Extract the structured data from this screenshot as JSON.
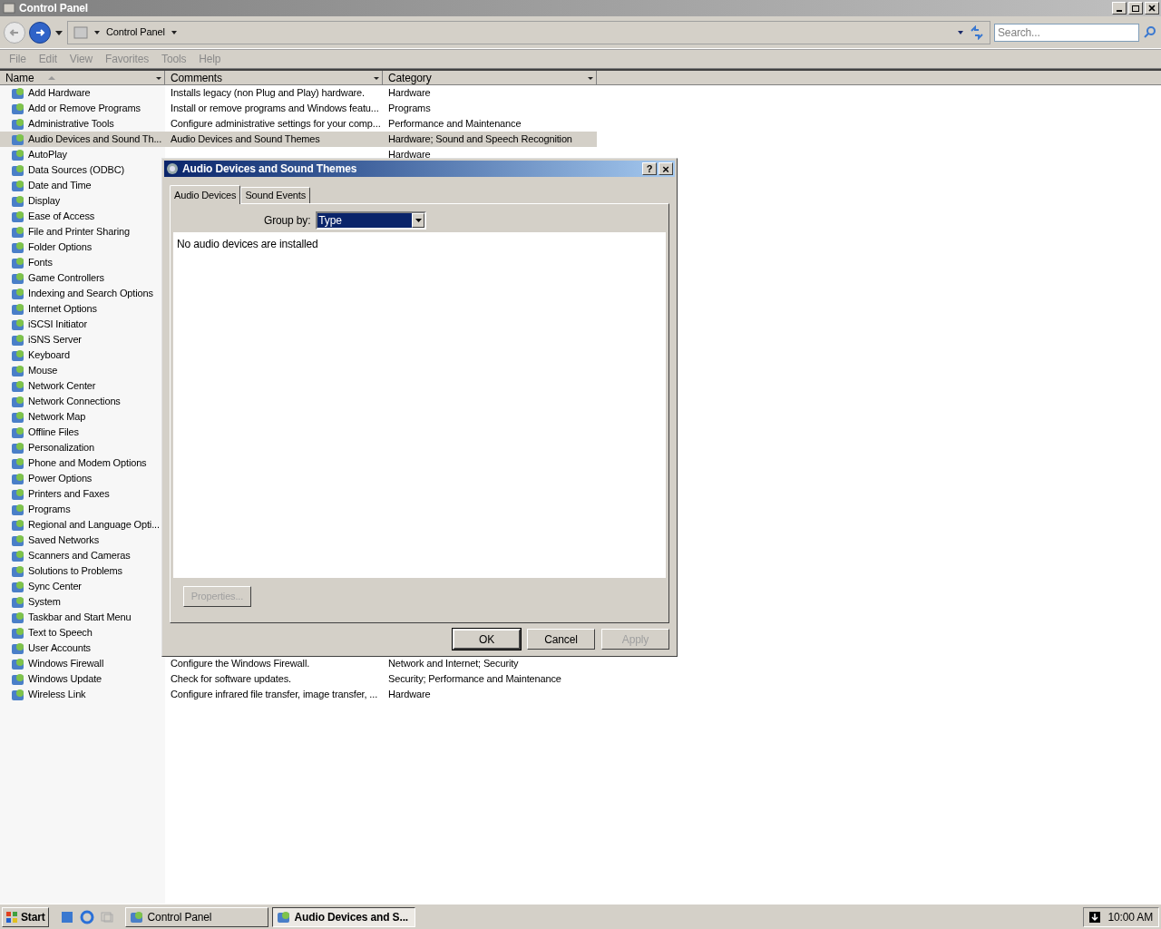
{
  "window": {
    "title": "Control Panel"
  },
  "address": {
    "path": "Control Panel"
  },
  "search": {
    "placeholder": "Search..."
  },
  "menu": [
    "File",
    "Edit",
    "View",
    "Favorites",
    "Tools",
    "Help"
  ],
  "columns": [
    {
      "label": "Name",
      "sorted": true
    },
    {
      "label": "Comments",
      "sorted": false
    },
    {
      "label": "Category",
      "sorted": false
    }
  ],
  "rows": [
    {
      "name": "Add Hardware",
      "comment": "Installs legacy (non Plug and Play) hardware.",
      "category": "Hardware",
      "selected": false
    },
    {
      "name": "Add or Remove Programs",
      "comment": "Install or remove programs and Windows featu...",
      "category": "Programs",
      "selected": false
    },
    {
      "name": "Administrative Tools",
      "comment": "Configure administrative settings for your comp...",
      "category": "Performance and Maintenance",
      "selected": false
    },
    {
      "name": "Audio Devices and Sound Th...",
      "comment": "Audio Devices and Sound Themes",
      "category": "Hardware; Sound and Speech Recognition",
      "selected": true
    },
    {
      "name": "AutoPlay",
      "category": "Hardware",
      "selected": false
    },
    {
      "name": "Data Sources (ODBC)",
      "selected": false
    },
    {
      "name": "Date and Time",
      "selected": false
    },
    {
      "name": "Display",
      "selected": false
    },
    {
      "name": "Ease of Access",
      "selected": false
    },
    {
      "name": "File and Printer Sharing",
      "selected": false
    },
    {
      "name": "Folder Options",
      "selected": false
    },
    {
      "name": "Fonts",
      "selected": false
    },
    {
      "name": "Game Controllers",
      "selected": false
    },
    {
      "name": "Indexing and Search Options",
      "selected": false
    },
    {
      "name": "Internet Options",
      "selected": false
    },
    {
      "name": "iSCSI Initiator",
      "selected": false
    },
    {
      "name": "iSNS Server",
      "selected": false
    },
    {
      "name": "Keyboard",
      "selected": false
    },
    {
      "name": "Mouse",
      "selected": false
    },
    {
      "name": "Network Center",
      "selected": false
    },
    {
      "name": "Network Connections",
      "selected": false
    },
    {
      "name": "Network Map",
      "selected": false
    },
    {
      "name": "Offline Files",
      "selected": false
    },
    {
      "name": "Personalization",
      "selected": false
    },
    {
      "name": "Phone and Modem Options",
      "selected": false
    },
    {
      "name": "Power Options",
      "selected": false
    },
    {
      "name": "Printers and Faxes",
      "selected": false
    },
    {
      "name": "Programs",
      "selected": false
    },
    {
      "name": "Regional and Language Opti...",
      "selected": false
    },
    {
      "name": "Saved Networks",
      "selected": false
    },
    {
      "name": "Scanners and Cameras",
      "selected": false
    },
    {
      "name": "Solutions to Problems",
      "selected": false
    },
    {
      "name": "Sync Center",
      "selected": false
    },
    {
      "name": "System",
      "selected": false
    },
    {
      "name": "Taskbar and Start Menu",
      "selected": false
    },
    {
      "name": "Text to Speech",
      "selected": false
    },
    {
      "name": "User Accounts",
      "selected": false
    },
    {
      "name": "Windows Firewall",
      "comment": "Configure the Windows Firewall.",
      "category": "Network and Internet; Security",
      "selected": false
    },
    {
      "name": "Windows Update",
      "comment": "Check for software updates.",
      "category": "Security; Performance and Maintenance",
      "selected": false
    },
    {
      "name": "Wireless Link",
      "comment": "Configure infrared file transfer, image transfer, ...",
      "category": "Hardware",
      "selected": false
    }
  ],
  "dialog": {
    "title": "Audio Devices and Sound Themes",
    "help": "?",
    "close": "×",
    "tabs": [
      {
        "label": "Audio Devices",
        "selected": true
      },
      {
        "label": "Sound Events",
        "selected": false
      }
    ],
    "group_by": {
      "label": "Group by:",
      "value": "Type"
    },
    "message": "No audio devices are installed",
    "properties": {
      "label": "Properties...",
      "disabled": true
    },
    "buttons": [
      {
        "label": "OK",
        "default": true,
        "disabled": false
      },
      {
        "label": "Cancel",
        "default": false,
        "disabled": false
      },
      {
        "label": "Apply",
        "default": false,
        "disabled": true
      }
    ]
  },
  "taskbar": {
    "start": "Start",
    "tasks": [
      {
        "label": "Control Panel",
        "selected": false
      },
      {
        "label": "Audio Devices and S...",
        "selected": true
      }
    ],
    "clock": "10:00 AM"
  }
}
